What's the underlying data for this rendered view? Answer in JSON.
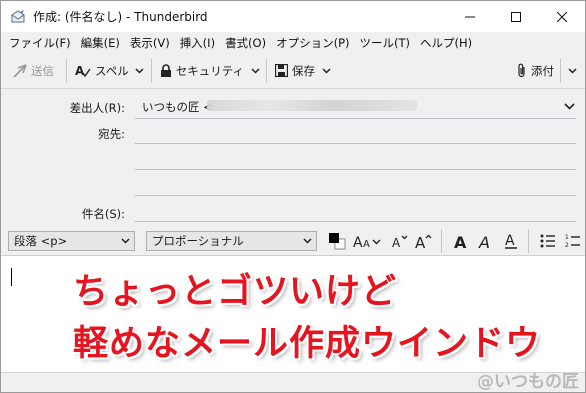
{
  "window": {
    "title": "作成: (件名なし) - Thunderbird"
  },
  "menubar": {
    "items": [
      "ファイル(F)",
      "編集(E)",
      "表示(V)",
      "挿入(I)",
      "書式(O)",
      "オプション(P)",
      "ツール(T)",
      "ヘルプ(H)"
    ]
  },
  "toolbar": {
    "send_label": "送信",
    "spell_label": "スペル",
    "security_label": "セキュリティ",
    "save_label": "保存",
    "attach_label": "添付"
  },
  "headers": {
    "from_label": "差出人(R):",
    "from_value": "いつもの匠 <",
    "to_label": "宛先:",
    "subject_label": "件名(S):"
  },
  "formatbar": {
    "paragraph_value": "段落 <p>",
    "font_value": "プロポーショナル"
  },
  "overlay": {
    "line1": "ちょっとゴツいけど",
    "line2": "軽めなメール作成ウインドウ",
    "color": "#e5141e"
  },
  "watermark": "@いつもの匠"
}
